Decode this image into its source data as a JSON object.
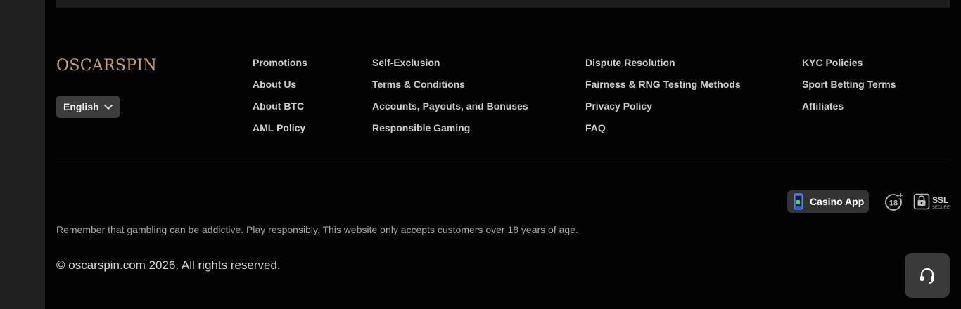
{
  "brand": {
    "logo_text": "OSCARSPIN",
    "accent_color": "#c9a76a"
  },
  "language": {
    "selected": "English"
  },
  "footer_links": {
    "col1": [
      "Promotions",
      "About Us",
      "About BTC",
      "AML Policy"
    ],
    "col2": [
      "Self-Exclusion",
      "Terms & Conditions",
      "Accounts, Payouts, and Bonuses",
      "Responsible Gaming"
    ],
    "col3": [
      "Dispute Resolution",
      "Fairness & RNG Testing Methods",
      "Privacy Policy",
      "FAQ"
    ],
    "col4": [
      "KYC Policies",
      "Sport Betting Terms",
      "Affiliates"
    ]
  },
  "badges": {
    "casino_app": "Casino App",
    "age": "18",
    "ssl": "SSL",
    "ssl_sub": "SECURE"
  },
  "disclaimer": "Remember that gambling can be addictive. Play responsibly. This website only accepts customers over 18 years of age.",
  "copyright": "© oscarspin.com 2026. All rights reserved.",
  "icons": {
    "language_chevron": "chevron-down-icon",
    "app": "phone-icon",
    "age": "age-18-icon",
    "ssl": "lock-icon",
    "support": "headset-icon"
  }
}
